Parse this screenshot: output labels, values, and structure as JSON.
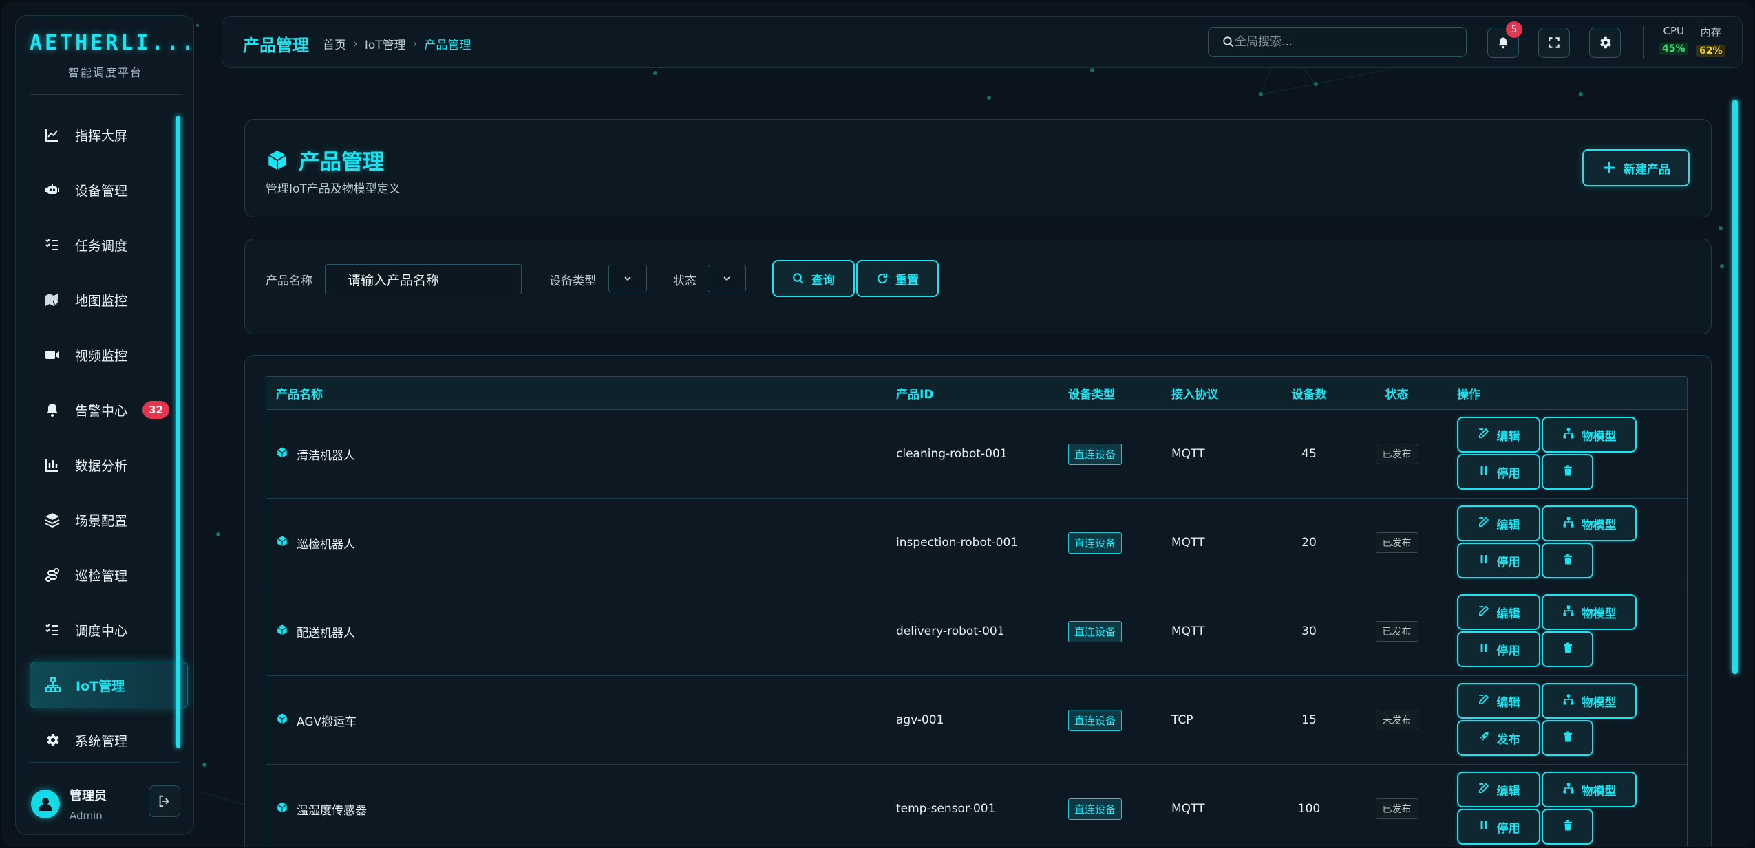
{
  "sidebar": {
    "logo": "AETHERLI...",
    "subtitle": "智能调度平台",
    "items": [
      {
        "label": "指挥大屏",
        "icon": "chart-line-icon"
      },
      {
        "label": "设备管理",
        "icon": "robot-icon"
      },
      {
        "label": "任务调度",
        "icon": "list-check-icon"
      },
      {
        "label": "地图监控",
        "icon": "map-marker-icon"
      },
      {
        "label": "视频监控",
        "icon": "video-icon"
      },
      {
        "label": "告警中心",
        "icon": "bell-icon",
        "badge": "32"
      },
      {
        "label": "数据分析",
        "icon": "bar-chart-icon"
      },
      {
        "label": "场景配置",
        "icon": "layers-icon"
      },
      {
        "label": "巡检管理",
        "icon": "route-icon"
      },
      {
        "label": "调度中心",
        "icon": "list-check-icon"
      },
      {
        "label": "IoT管理",
        "icon": "network-icon",
        "active": true
      },
      {
        "label": "系统管理",
        "icon": "gear-icon"
      }
    ],
    "user": {
      "name": "管理员",
      "role": "Admin"
    }
  },
  "header": {
    "title": "产品管理",
    "breadcrumb": [
      "首页",
      "IoT管理",
      "产品管理"
    ],
    "search_placeholder": "全局搜索...",
    "notification_count": "5",
    "cpu_label": "CPU",
    "cpu_value": "45%",
    "mem_label": "内存",
    "mem_value": "62%"
  },
  "page": {
    "title": "产品管理",
    "subtitle": "管理IoT产品及物模型定义",
    "new_button": "新建产品"
  },
  "filters": {
    "name_label": "产品名称",
    "name_placeholder": "请输入产品名称",
    "type_label": "设备类型",
    "status_label": "状态",
    "query_button": "查询",
    "reset_button": "重置"
  },
  "table": {
    "headers": [
      "产品名称",
      "产品ID",
      "设备类型",
      "接入协议",
      "设备数",
      "状态",
      "操作"
    ],
    "rows": [
      {
        "name": "清洁机器人",
        "id": "cleaning-robot-001",
        "type": "直连设备",
        "protocol": "MQTT",
        "count": "45",
        "status": "已发布",
        "toggle": "停用"
      },
      {
        "name": "巡检机器人",
        "id": "inspection-robot-001",
        "type": "直连设备",
        "protocol": "MQTT",
        "count": "20",
        "status": "已发布",
        "toggle": "停用"
      },
      {
        "name": "配送机器人",
        "id": "delivery-robot-001",
        "type": "直连设备",
        "protocol": "MQTT",
        "count": "30",
        "status": "已发布",
        "toggle": "停用"
      },
      {
        "name": "AGV搬运车",
        "id": "agv-001",
        "type": "直连设备",
        "protocol": "TCP",
        "count": "15",
        "status": "未发布",
        "toggle": "发布"
      },
      {
        "name": "温湿度传感器",
        "id": "temp-sensor-001",
        "type": "直连设备",
        "protocol": "MQTT",
        "count": "100",
        "status": "已发布",
        "toggle": "停用"
      }
    ],
    "edit_label": "编辑",
    "model_label": "物模型"
  },
  "colors": {
    "accent": "#19e4f2",
    "badge": "#e5344e",
    "cpu": "#35e07a",
    "mem": "#e8d23a"
  }
}
